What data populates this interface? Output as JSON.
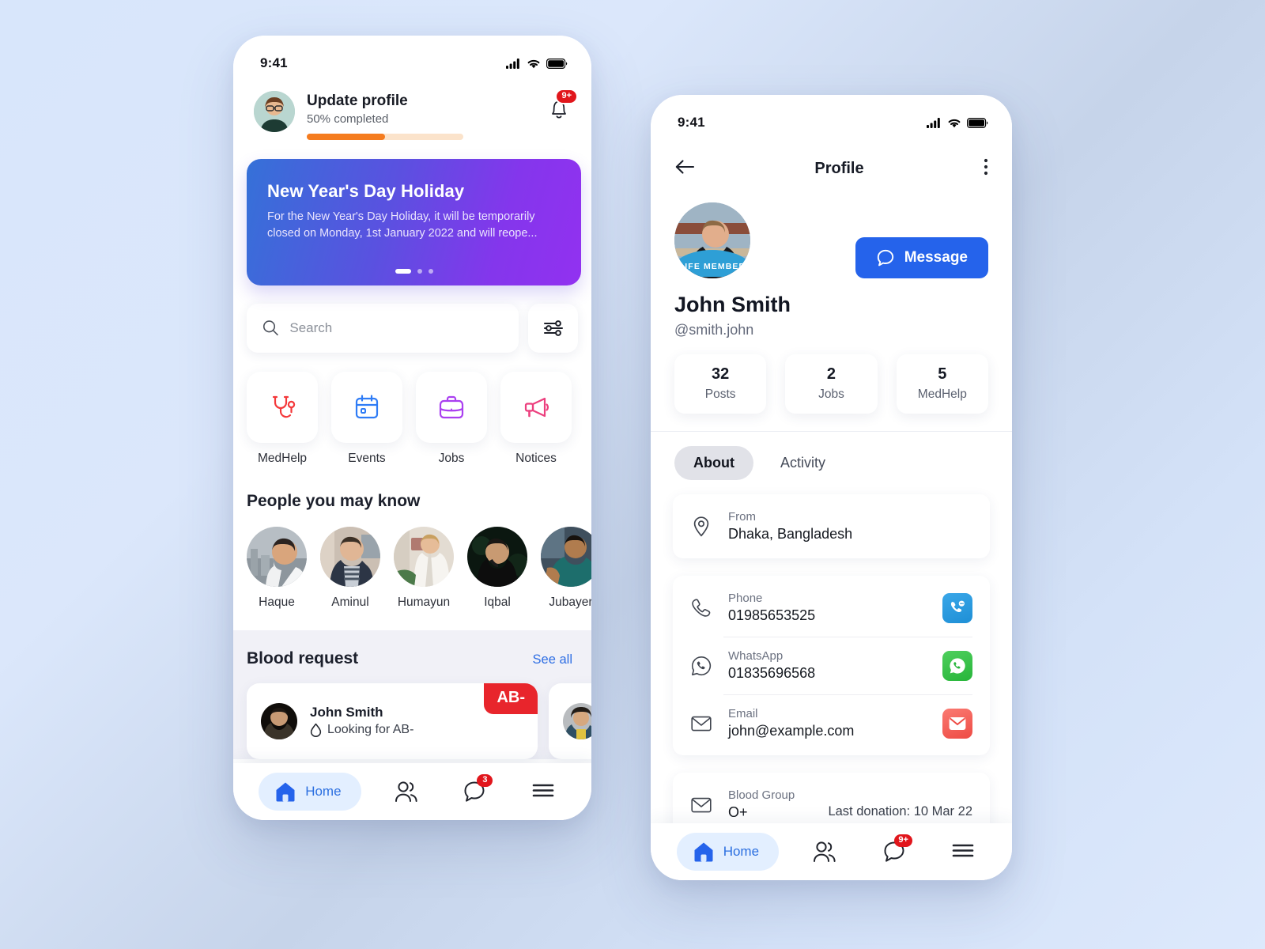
{
  "background": {
    "accent_blue": "#2563eb",
    "danger_red": "#e1161c",
    "orange": "#f57c1f"
  },
  "home": {
    "statusbar": {
      "time": "9:41"
    },
    "update_profile": {
      "title": "Update profile",
      "subtitle": "50% completed",
      "progress_percent": 50,
      "notification_count": "9+"
    },
    "banner": {
      "title": "New Year's Day Holiday",
      "text": "For the New Year's Day Holiday, it will be temporarily closed on Monday, 1st January 2022 and will reope...",
      "slide_count": 3,
      "active_slide": 1
    },
    "search": {
      "placeholder": "Search",
      "value": ""
    },
    "categories": [
      {
        "label": "MedHelp",
        "icon": "stethoscope-icon",
        "color": "#f4383a"
      },
      {
        "label": "Events",
        "icon": "calendar-icon",
        "color": "#2f7cf6"
      },
      {
        "label": "Jobs",
        "icon": "briefcase-icon",
        "color": "#aa3ff0"
      },
      {
        "label": "Notices",
        "icon": "megaphone-icon",
        "color": "#ec3f7e"
      }
    ],
    "people_section": {
      "title": "People you may know",
      "people": [
        {
          "name": "Haque"
        },
        {
          "name": "Aminul"
        },
        {
          "name": "Humayun"
        },
        {
          "name": "Iqbal"
        },
        {
          "name": "Jubayer"
        }
      ]
    },
    "blood_section": {
      "title": "Blood request",
      "see_all": "See all",
      "cards": [
        {
          "name": "John Smith",
          "subtitle": "Looking for AB-",
          "tag": "AB-"
        }
      ]
    },
    "bottom_nav": {
      "home_label": "Home",
      "chat_badge": "3"
    }
  },
  "profile": {
    "statusbar": {
      "time": "9:41"
    },
    "header": {
      "title": "Profile"
    },
    "user": {
      "name": "John Smith",
      "handle": "@smith.john",
      "badge": "LIFE MEMBER",
      "message_button": "Message"
    },
    "stats": [
      {
        "value": "32",
        "label": "Posts"
      },
      {
        "value": "2",
        "label": "Jobs"
      },
      {
        "value": "5",
        "label": "MedHelp"
      }
    ],
    "tabs": [
      {
        "label": "About",
        "active": true
      },
      {
        "label": "Activity",
        "active": false
      }
    ],
    "info": {
      "from": {
        "label": "From",
        "value": "Dhaka, Bangladesh",
        "icon": "location-pin-icon"
      },
      "phone": {
        "label": "Phone",
        "value": "01985653525",
        "icon": "phone-icon",
        "action_icon": "viber-icon"
      },
      "whatsapp": {
        "label": "WhatsApp",
        "value": "01835696568",
        "icon": "whatsapp-outline-icon",
        "action_icon": "whatsapp-icon"
      },
      "email": {
        "label": "Email",
        "value": "john@example.com",
        "icon": "envelope-icon",
        "action_icon": "mail-icon"
      },
      "blood": {
        "label": "Blood Group",
        "value": "O+",
        "aside": "Last donation: 10 Mar 22",
        "icon": "envelope-icon"
      }
    },
    "bottom_nav": {
      "home_label": "Home",
      "chat_badge": "9+"
    }
  }
}
